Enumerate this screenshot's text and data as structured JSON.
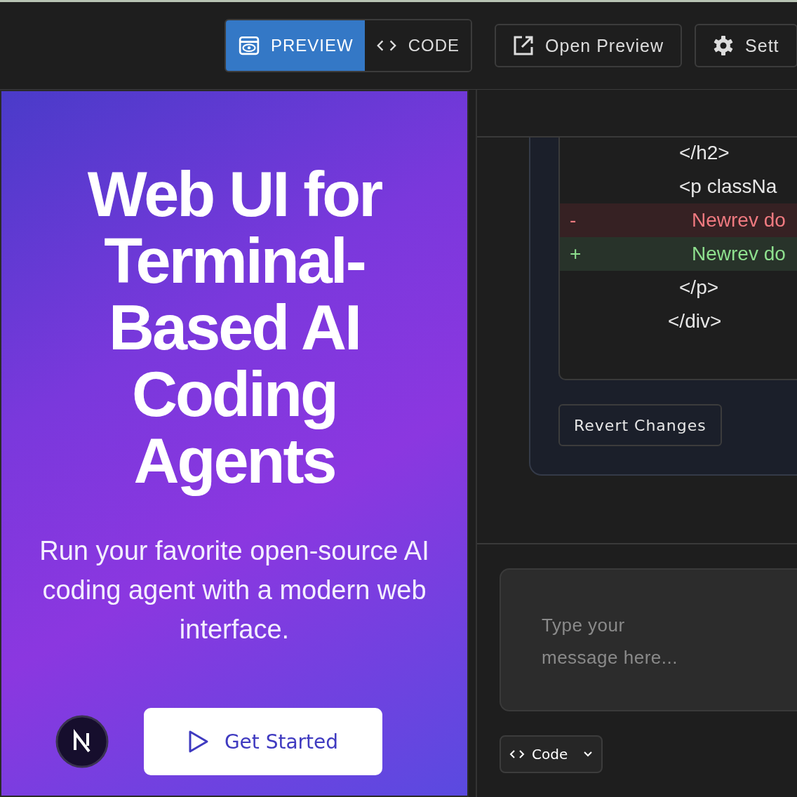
{
  "toolbar": {
    "view_tabs": [
      {
        "label": "PREVIEW",
        "kind": "preview",
        "selected": true
      },
      {
        "label": "CODE",
        "kind": "code",
        "selected": false
      }
    ],
    "buttons": [
      {
        "label": "Open Preview",
        "kind": "open"
      },
      {
        "label": "Sett",
        "kind": "settings"
      }
    ]
  },
  "preview": {
    "headline": "Web UI for Terminal-Based AI Coding Agents",
    "subtitle": "Run your favorite open-source AI coding agent with a modern web interface.",
    "cta": "Get Started"
  },
  "diff": {
    "lines": [
      {
        "kind": "context",
        "text": "</h2>"
      },
      {
        "kind": "context",
        "text": "<p classNa"
      },
      {
        "kind": "removed",
        "marker": "-",
        "text": "Newrev do"
      },
      {
        "kind": "added",
        "marker": "+",
        "text": "Newrev do"
      },
      {
        "kind": "context",
        "text": "</p>"
      },
      {
        "kind": "outer",
        "text": "</div>"
      }
    ],
    "revert_button": "Revert Changes"
  },
  "chat": {
    "placeholder": "Type your message here...",
    "mode_select": "Code"
  }
}
